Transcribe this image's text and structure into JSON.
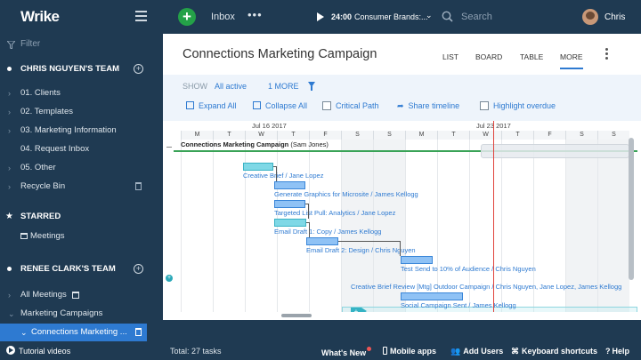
{
  "topbar": {
    "logo": "Wrike",
    "inbox": "Inbox",
    "more": "•••",
    "timer_time": "24:00",
    "timer_task": "Consumer Brands:...",
    "search_placeholder": "Search",
    "user_name": "Chris"
  },
  "sidebar": {
    "filter_placeholder": "Filter",
    "team1": "CHRIS NGUYEN'S TEAM",
    "team1_items": [
      "01. Clients",
      "02. Templates",
      "03. Marketing Information",
      "04. Request Inbox",
      "05. Other",
      "Recycle Bin"
    ],
    "starred": "STARRED",
    "starred_items": [
      "Meetings"
    ],
    "team2": "RENEE CLARK'S TEAM",
    "team2_items": [
      "All Meetings",
      "Marketing Campaigns",
      "Connections Marketing ..."
    ]
  },
  "project": {
    "title": "Connections Marketing Campaign",
    "views": [
      "LIST",
      "BOARD",
      "TABLE",
      "MORE"
    ],
    "active_view": "MORE"
  },
  "filterbar": {
    "show_label": "SHOW",
    "show_value": "All active",
    "more_filters": "1 MORE",
    "expand_all": "Expand All",
    "collapse_all": "Collapse All",
    "critical_path": "Critical Path",
    "share_timeline": "Share timeline",
    "highlight_overdue": "Highlight overdue"
  },
  "gantt": {
    "weeks": [
      "Jul 16 2017",
      "Jul 23 2017"
    ],
    "days": [
      "M",
      "T",
      "W",
      "T",
      "F",
      "S",
      "S",
      "M",
      "T",
      "W",
      "T",
      "F",
      "S",
      "S"
    ],
    "project_row": {
      "name": "Connections Marketing Campaign",
      "owner": "(Sam Jones)"
    },
    "tasks": [
      "Creative Brief / Jane Lopez",
      "Generate Graphics for Microsite / James Kellogg",
      "Targeted List Pull: Analytics / Jane Lopez",
      "Email Draft 1: Copy / James Kellogg",
      "Email Draft 2: Design / Chris Nguyen",
      "Test Send to 10% of Audience / Chris Nguyen",
      "Creative Brief Review [Mtg] Outdoor Campaign / Chris Nguyen, Jane Lopez, James Kellogg",
      "Social Campaign Sent / James Kellogg"
    ]
  },
  "bottombar": {
    "tutorial": "Tutorial videos",
    "total": "Total: 27 tasks",
    "whats_new": "What's New",
    "mobile": "Mobile apps",
    "add_users": "Add Users",
    "shortcuts": "Keyboard shortcuts",
    "help": "Help"
  },
  "colors": {
    "sidebar_bg": "#1f3a52",
    "accent": "#2e7ad1",
    "add_green": "#24a148",
    "today_line": "#e0443e"
  }
}
